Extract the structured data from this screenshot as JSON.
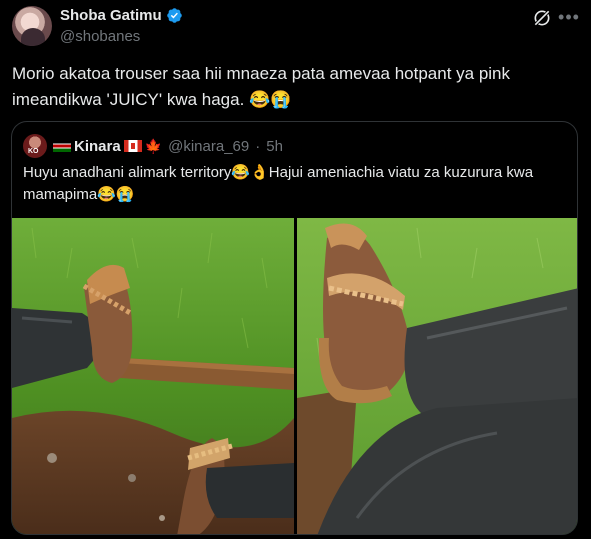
{
  "post": {
    "author": {
      "display_name": "Shoba Gatimu",
      "handle": "@shobanes",
      "verified": true,
      "verified_color": "#1d9bf0"
    },
    "text": "Morio akatoa trouser saa hii mnaeza pata amevaa hotpant ya pink imeandikwa 'JUICY' kwa haga. 😂😭",
    "grok_icon": "grok-icon",
    "more_icon": "more-horizontal-icon"
  },
  "quote": {
    "author": {
      "name": "Kinara",
      "flags": [
        "kenya-flag",
        "canada-flag"
      ],
      "handle": "@kinara_69",
      "separator": "·",
      "time": "5h"
    },
    "text": "Huyu anadhani alimark territory😂👌Hajui ameniachia viatu za kuzurura kwa mamapima😂😭",
    "media": [
      {
        "icon": "photo-sandals-on-grass-with-stick"
      },
      {
        "icon": "photo-crossed-legs-sandal-close-up"
      }
    ]
  },
  "colors": {
    "background": "#000000",
    "text_primary": "#e7e9ea",
    "text_secondary": "#71767b",
    "border": "#2f3336",
    "accent": "#1d9bf0"
  }
}
